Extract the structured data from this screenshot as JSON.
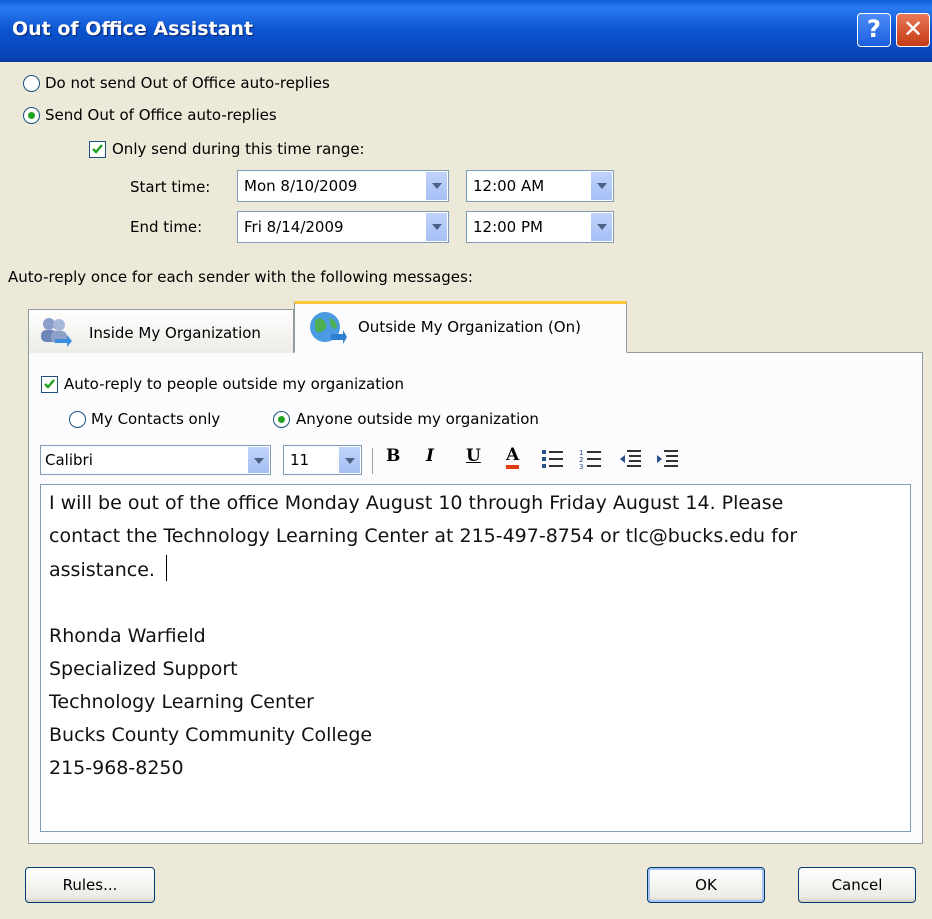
{
  "window": {
    "title": "Out of Office Assistant"
  },
  "auto_reply_mode": {
    "do_not_send_label": "Do not send Out of Office auto-replies",
    "send_label": "Send Out of Office auto-replies",
    "selected": "send"
  },
  "time_range": {
    "only_send_label": "Only send during this time range:",
    "only_send_checked": true,
    "start_label": "Start time:",
    "start_date": "Mon 8/10/2009",
    "start_time": "12:00 AM",
    "end_label": "End time:",
    "end_date": "Fri 8/14/2009",
    "end_time": "12:00 PM"
  },
  "messages_heading": "Auto-reply once for each sender with the following messages:",
  "tabs": [
    {
      "label": "Inside My Organization",
      "active": false
    },
    {
      "label": "Outside My Organization (On)",
      "active": true
    }
  ],
  "outside": {
    "auto_reply_label": "Auto-reply to people outside my organization",
    "auto_reply_checked": true,
    "my_contacts_label": "My Contacts only",
    "anyone_label": "Anyone outside my organization",
    "audience_selected": "anyone"
  },
  "formatting": {
    "font": "Calibri",
    "size": "11",
    "bold": "B",
    "italic": "I",
    "underline": "U",
    "font_color": "A",
    "font_color_hex": "#e03c10"
  },
  "message_lines": [
    "I will be out of the office Monday August 10 through Friday August 14.  Please",
    "contact the Technology Learning Center at 215-497-8754 or tlc@bucks.edu for",
    "assistance.",
    "",
    "Rhonda Warfield",
    "Specialized Support",
    "Technology Learning Center",
    "Bucks County Community College",
    "215-968-8250"
  ],
  "buttons": {
    "rules": "Rules...",
    "ok": "OK",
    "cancel": "Cancel"
  },
  "colors": {
    "titlebar": "#0a53cf",
    "dialog_bg": "#ece9d8",
    "active_tab_accent": "#ffc83c"
  }
}
